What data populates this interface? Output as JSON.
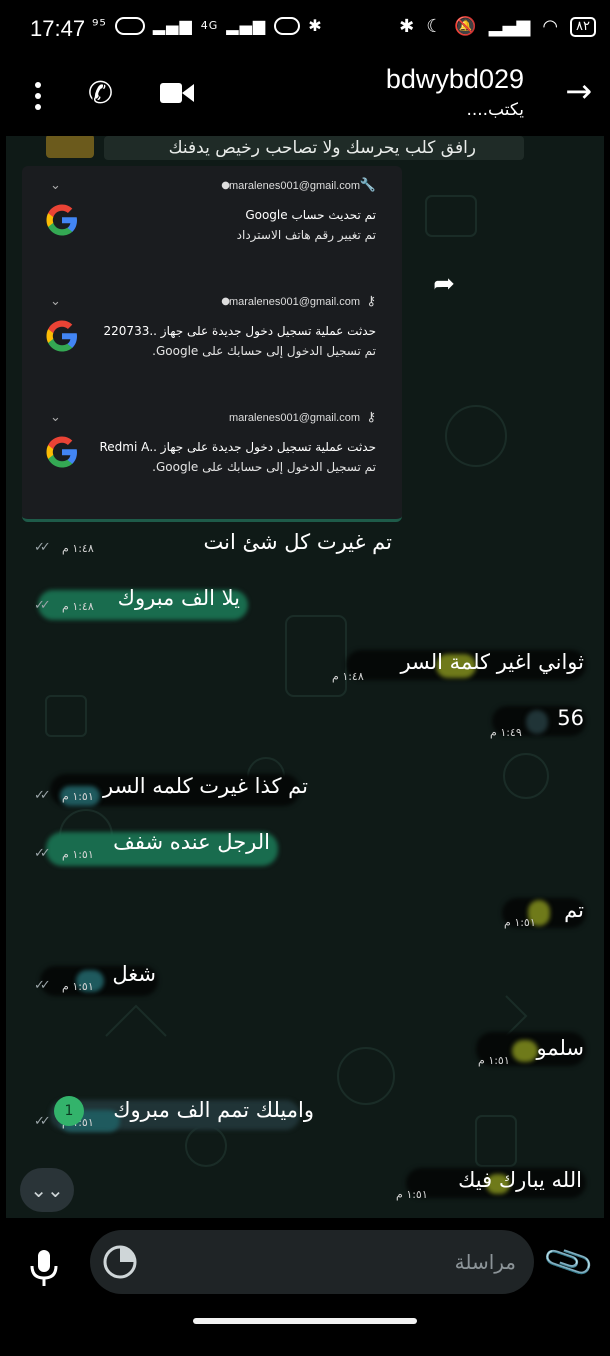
{
  "status_bar": {
    "time": "17:47",
    "left_icons_text": "⁹⁵",
    "network": "4G",
    "battery": "٨٢"
  },
  "header": {
    "contact_name": "bdwybd029",
    "contact_status": "يكتب...."
  },
  "quoted_message": {
    "text": "رافق كلب يحرسك ولا تصاحب رخيص يدفنك"
  },
  "notifications": [
    {
      "account": "maralenes001@gmail.com",
      "title": "تم تحديث حساب Google",
      "body": "تم تغيير رقم هاتف الاسترداد",
      "icon": "wrench-icon"
    },
    {
      "account": "maralenes001@gmail.com",
      "title": "حدثت عملية تسجيل دخول جديدة على جهاز ..220733",
      "body": "تم تسجيل الدخول إلى حسابك على Google.",
      "icon": "key-icon"
    },
    {
      "account": "maralenes001@gmail.com",
      "title": "حدثت عملية تسجيل دخول جديدة على جهاز ..Redmi A",
      "body": "تم تسجيل الدخول إلى حسابك على Google.",
      "icon": "key-icon"
    }
  ],
  "messages": [
    {
      "text": "تم غيرت كل شئ انت",
      "time": "١:٤٨ م",
      "side": "out"
    },
    {
      "text": "يلا الف مبروك",
      "time": "١:٤٨ م",
      "side": "out"
    },
    {
      "text": "ثواني اغير كلمة السر",
      "time": "١:٤٨ م",
      "side": "in"
    },
    {
      "text": "56",
      "time": "١:٤٩ م",
      "side": "in"
    },
    {
      "text": "تم كذا غيرت كلمه السر",
      "time": "١:٥١ م",
      "side": "out"
    },
    {
      "text": "الرجل عنده شفف",
      "time": "١:٥١ م",
      "side": "out"
    },
    {
      "text": "تم",
      "time": "١:٥١ م",
      "side": "in"
    },
    {
      "text": "شغل",
      "time": "١:٥١ م",
      "side": "out"
    },
    {
      "text": "سلمو",
      "time": "١:٥١ م",
      "side": "in"
    },
    {
      "text": "واميلك تمم الف مبروك",
      "time": "١:٥١ م",
      "side": "out"
    },
    {
      "text": "الله يبارك فيك",
      "time": "١:٥١ م",
      "side": "in"
    }
  ],
  "unread_count": "1",
  "input": {
    "placeholder": "مراسلة"
  },
  "colors": {
    "chat_background": "#0f1a17",
    "green_highlight": "#196c4e",
    "badge_green": "#33b36b"
  }
}
